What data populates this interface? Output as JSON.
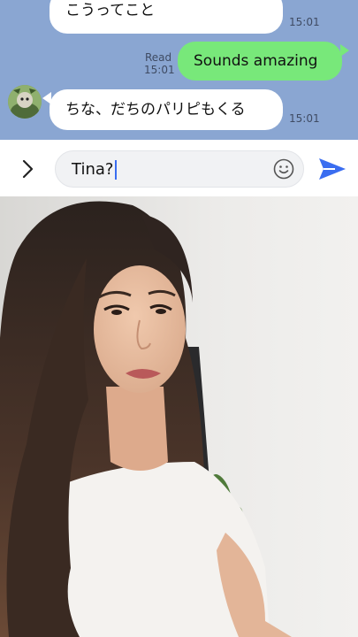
{
  "messages": [
    {
      "side": "in",
      "text": "こうってこと",
      "time": "15:01"
    },
    {
      "side": "out",
      "text": "Sounds amazing",
      "read": "Read",
      "time": "15:01"
    },
    {
      "side": "in",
      "text": "ちな、だちのパリピもくる",
      "time": "15:01"
    }
  ],
  "composer": {
    "value": "Tina?",
    "expand_icon": "chevron-right-icon",
    "emoji_icon": "smiley-icon",
    "send_icon": "send-icon"
  },
  "colors": {
    "chat_background": "#8aa6d2",
    "outgoing_bubble": "#78e87a",
    "incoming_bubble": "#ffffff",
    "send_accent": "#3a6df0"
  }
}
